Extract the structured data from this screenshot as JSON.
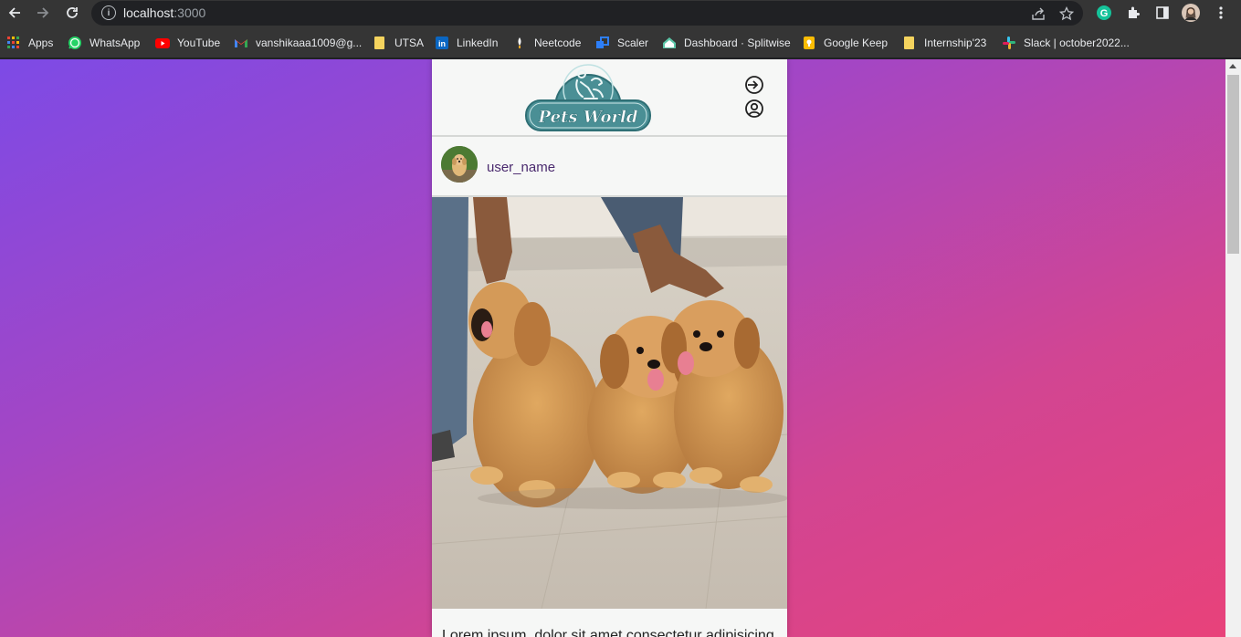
{
  "browser": {
    "url_host": "localhost",
    "url_port": ":3000",
    "bookmarks": [
      {
        "label": "Apps",
        "icon": "apps-grid-icon",
        "color": "#ea4335"
      },
      {
        "label": "WhatsApp",
        "icon": "whatsapp-icon",
        "color": "#25d366"
      },
      {
        "label": "YouTube",
        "icon": "youtube-icon",
        "color": "#ff0000"
      },
      {
        "label": "vanshikaaa1009@g...",
        "icon": "gmail-icon",
        "color": "#ea4335"
      },
      {
        "label": "UTSA",
        "icon": "folder-icon",
        "color": "#f4d35e"
      },
      {
        "label": "LinkedIn",
        "icon": "linkedin-icon",
        "color": "#0a66c2"
      },
      {
        "label": "Neetcode",
        "icon": "neetcode-icon",
        "color": "#ffffff"
      },
      {
        "label": "Scaler",
        "icon": "scaler-icon",
        "color": "#2d7ff9"
      },
      {
        "label": "Dashboard · Splitwise",
        "icon": "splitwise-icon",
        "color": "#5bc5a7"
      },
      {
        "label": "Google Keep",
        "icon": "keep-icon",
        "color": "#fbbc04"
      },
      {
        "label": "Internship'23",
        "icon": "folder-icon",
        "color": "#f4d35e"
      },
      {
        "label": "Slack | october2022...",
        "icon": "slack-icon",
        "color": "#e01e5a"
      }
    ]
  },
  "app": {
    "logo_text": "Pets World",
    "username": "user_name",
    "caption": "Lorem ipsum, dolor sit amet consectetur adipisicing"
  },
  "colors": {
    "accent": "#4a8f95",
    "gradient_start": "#7d4ae6",
    "gradient_end": "#e8427a",
    "username": "#4a2a6e"
  }
}
